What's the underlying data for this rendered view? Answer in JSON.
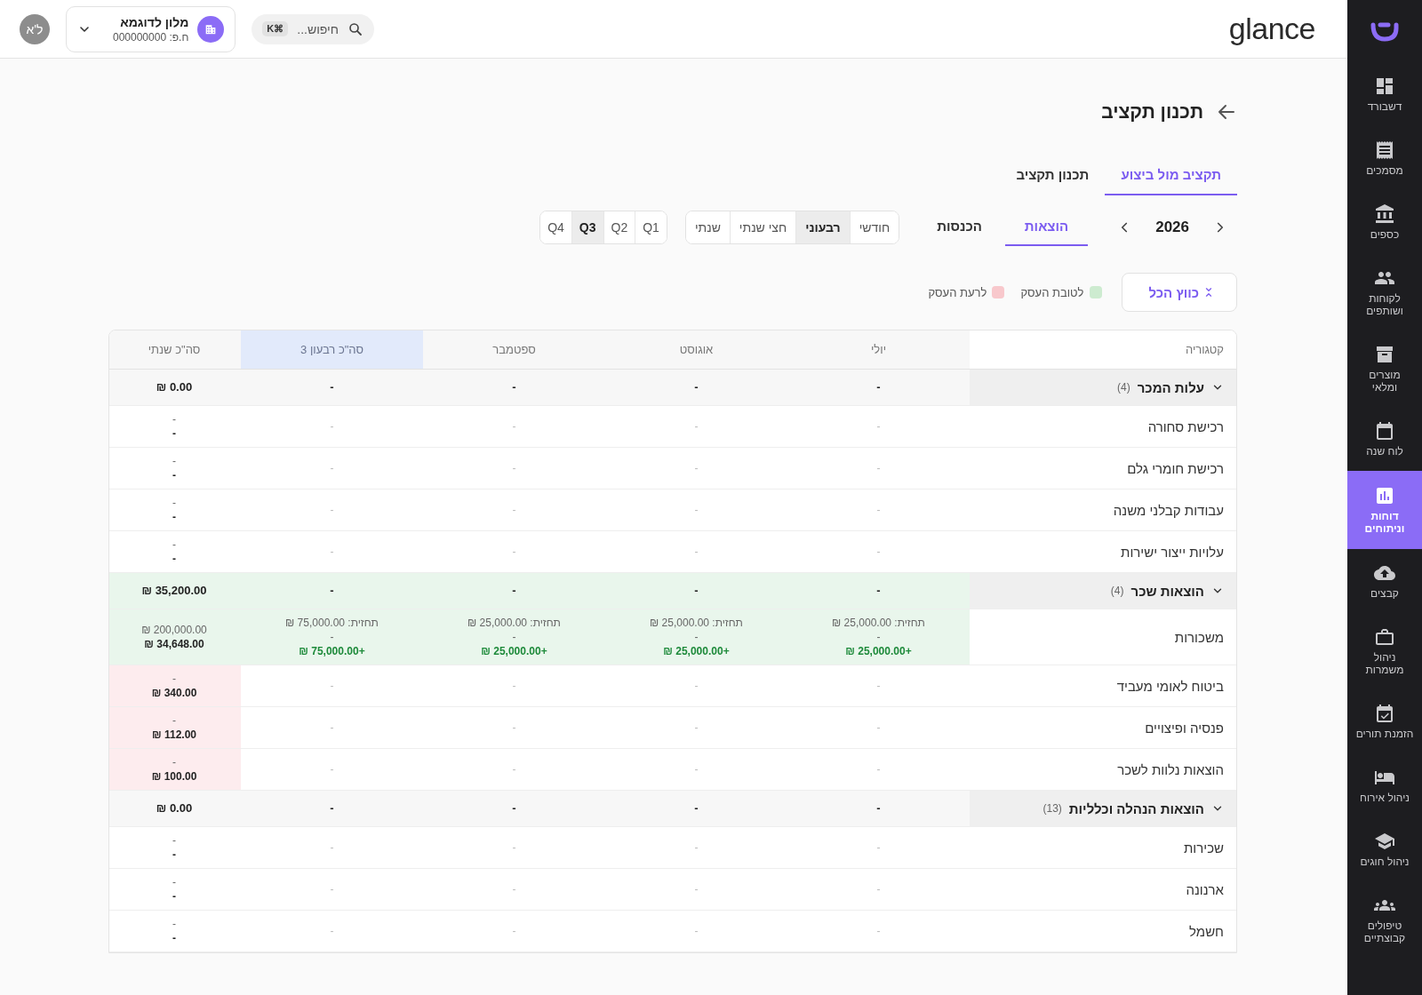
{
  "sidebar": {
    "items": [
      {
        "label": "דשבורד",
        "selected": false
      },
      {
        "label": "מסמכים",
        "selected": false
      },
      {
        "label": "כספים",
        "selected": false
      },
      {
        "label": "לקוחות ושותפים",
        "selected": false
      },
      {
        "label": "מוצרים ומלאי",
        "selected": false
      },
      {
        "label": "לוח שנה",
        "selected": false
      },
      {
        "label": "דוחות וניתוחים",
        "selected": true
      },
      {
        "label": "קבצים",
        "selected": false
      },
      {
        "label": "ניהול משמרות",
        "selected": false
      },
      {
        "label": "הזמנת תורים",
        "selected": false
      },
      {
        "label": "ניהול אירוח",
        "selected": false
      },
      {
        "label": "ניהול חוגים",
        "selected": false
      },
      {
        "label": "טיפולים קבוצתיים",
        "selected": false
      }
    ]
  },
  "top_bar": {
    "logo": "glance",
    "search": {
      "placeholder": "חיפוש...",
      "shortcut": "⌘K"
    },
    "business": {
      "name": "מלון לדוגמא",
      "id": "ח.פ: 000000000"
    },
    "avatar": "ל'א"
  },
  "page": {
    "title": "תכנון תקציב"
  },
  "view_tabs": [
    {
      "label": "תקציב מול ביצוע",
      "selected": true
    },
    {
      "label": "תכנון תקציב",
      "selected": false
    }
  ],
  "year": "2026",
  "type_tabs": [
    {
      "label": "הוצאות",
      "selected": true
    },
    {
      "label": "הכנסות",
      "selected": false
    }
  ],
  "periods": [
    {
      "label": "חודשי",
      "selected": false
    },
    {
      "label": "רבעוני",
      "selected": true
    },
    {
      "label": "חצי שנתי",
      "selected": false
    },
    {
      "label": "שנתי",
      "selected": false
    }
  ],
  "quarters": [
    {
      "label": "Q1",
      "selected": false
    },
    {
      "label": "Q2",
      "selected": false
    },
    {
      "label": "Q3",
      "selected": true
    },
    {
      "label": "Q4",
      "selected": false
    }
  ],
  "collapse_button": "כווץ הכל",
  "legend": [
    {
      "label": "לטובת העסק",
      "color": "#cdebd0"
    },
    {
      "label": "לרעת העסק",
      "color": "#f8c8cc"
    }
  ],
  "table": {
    "columns": [
      {
        "label": "קטגוריה",
        "highlighted": false
      },
      {
        "label": "יולי",
        "highlighted": false
      },
      {
        "label": "אוגוסט",
        "highlighted": false
      },
      {
        "label": "ספטמבר",
        "highlighted": false
      },
      {
        "label": "סה\"כ רבעון 3",
        "highlighted": true
      },
      {
        "label": "סה\"כ שנתי",
        "highlighted": false
      }
    ],
    "rows": [
      {
        "kind": "group",
        "expanded": true,
        "cells": [
          {
            "text": "עלות המכר",
            "count": "(4)"
          },
          {
            "lines": [
              {
                "kind": "total",
                "text": "-"
              }
            ]
          },
          {
            "lines": [
              {
                "kind": "total",
                "text": "-"
              }
            ]
          },
          {
            "lines": [
              {
                "kind": "total",
                "text": "-"
              }
            ]
          },
          {
            "lines": [
              {
                "kind": "total",
                "text": "-"
              }
            ]
          },
          {
            "lines": [
              {
                "kind": "total",
                "text": "0.00 ₪"
              }
            ]
          }
        ]
      },
      {
        "kind": "item",
        "cells": [
          {
            "text": "רכישת סחורה"
          },
          {
            "lines": [
              {
                "kind": "empty",
                "text": "-"
              }
            ]
          },
          {
            "lines": [
              {
                "kind": "empty",
                "text": "-"
              }
            ]
          },
          {
            "lines": [
              {
                "kind": "empty",
                "text": "-"
              }
            ]
          },
          {
            "lines": [
              {
                "kind": "empty",
                "text": "-"
              }
            ]
          },
          {
            "lines": [
              {
                "kind": "forecast",
                "text": "-"
              },
              {
                "kind": "actual",
                "text": "-"
              }
            ]
          }
        ]
      },
      {
        "kind": "item",
        "cells": [
          {
            "text": "רכישת חומרי גלם"
          },
          {
            "lines": [
              {
                "kind": "empty",
                "text": "-"
              }
            ]
          },
          {
            "lines": [
              {
                "kind": "empty",
                "text": "-"
              }
            ]
          },
          {
            "lines": [
              {
                "kind": "empty",
                "text": "-"
              }
            ]
          },
          {
            "lines": [
              {
                "kind": "empty",
                "text": "-"
              }
            ]
          },
          {
            "lines": [
              {
                "kind": "forecast",
                "text": "-"
              },
              {
                "kind": "actual",
                "text": "-"
              }
            ]
          }
        ]
      },
      {
        "kind": "item",
        "cells": [
          {
            "text": "עבודות קבלני משנה"
          },
          {
            "lines": [
              {
                "kind": "empty",
                "text": "-"
              }
            ]
          },
          {
            "lines": [
              {
                "kind": "empty",
                "text": "-"
              }
            ]
          },
          {
            "lines": [
              {
                "kind": "empty",
                "text": "-"
              }
            ]
          },
          {
            "lines": [
              {
                "kind": "empty",
                "text": "-"
              }
            ]
          },
          {
            "lines": [
              {
                "kind": "forecast",
                "text": "-"
              },
              {
                "kind": "actual",
                "text": "-"
              }
            ]
          }
        ]
      },
      {
        "kind": "item",
        "cells": [
          {
            "text": "עלויות ייצור ישירות"
          },
          {
            "lines": [
              {
                "kind": "empty",
                "text": "-"
              }
            ]
          },
          {
            "lines": [
              {
                "kind": "empty",
                "text": "-"
              }
            ]
          },
          {
            "lines": [
              {
                "kind": "empty",
                "text": "-"
              }
            ]
          },
          {
            "lines": [
              {
                "kind": "empty",
                "text": "-"
              }
            ]
          },
          {
            "lines": [
              {
                "kind": "forecast",
                "text": "-"
              },
              {
                "kind": "actual",
                "text": "-"
              }
            ]
          }
        ]
      },
      {
        "kind": "group",
        "expanded": true,
        "cells": [
          {
            "text": "הוצאות שכר",
            "count": "(4)"
          },
          {
            "color": "#e9f6ec",
            "lines": [
              {
                "kind": "total",
                "text": "-"
              }
            ]
          },
          {
            "color": "#e9f6ec",
            "lines": [
              {
                "kind": "total",
                "text": "-"
              }
            ]
          },
          {
            "color": "#e9f6ec",
            "lines": [
              {
                "kind": "total",
                "text": "-"
              }
            ]
          },
          {
            "color": "#e9f6ec",
            "lines": [
              {
                "kind": "total",
                "text": "-"
              }
            ]
          },
          {
            "color": "#e9f6ec",
            "lines": [
              {
                "kind": "total",
                "text": "35,200.00 ₪"
              }
            ]
          }
        ]
      },
      {
        "kind": "item",
        "cells": [
          {
            "text": "משכורות"
          },
          {
            "color": "#e9f6ec",
            "lines": [
              {
                "kind": "forecast",
                "text": "תחזית: 25,000.00 ₪"
              },
              {
                "kind": "forecast",
                "text": "-"
              },
              {
                "kind": "variance",
                "text": "+25,000.00 ₪"
              }
            ]
          },
          {
            "color": "#e9f6ec",
            "lines": [
              {
                "kind": "forecast",
                "text": "תחזית: 25,000.00 ₪"
              },
              {
                "kind": "forecast",
                "text": "-"
              },
              {
                "kind": "variance",
                "text": "+25,000.00 ₪"
              }
            ]
          },
          {
            "color": "#e9f6ec",
            "lines": [
              {
                "kind": "forecast",
                "text": "תחזית: 25,000.00 ₪"
              },
              {
                "kind": "forecast",
                "text": "-"
              },
              {
                "kind": "variance",
                "text": "+25,000.00 ₪"
              }
            ]
          },
          {
            "color": "#e9f6ec",
            "lines": [
              {
                "kind": "forecast",
                "text": "תחזית: 75,000.00 ₪"
              },
              {
                "kind": "forecast",
                "text": "-"
              },
              {
                "kind": "variance",
                "text": "+75,000.00 ₪"
              }
            ]
          },
          {
            "color": "#e9f6ec",
            "lines": [
              {
                "kind": "forecast",
                "text": "200,000.00 ₪"
              },
              {
                "kind": "actual",
                "text": "34,648.00 ₪"
              }
            ]
          }
        ]
      },
      {
        "kind": "item",
        "cells": [
          {
            "text": "ביטוח לאומי מעביד"
          },
          {
            "lines": [
              {
                "kind": "empty",
                "text": "-"
              }
            ]
          },
          {
            "lines": [
              {
                "kind": "empty",
                "text": "-"
              }
            ]
          },
          {
            "lines": [
              {
                "kind": "empty",
                "text": "-"
              }
            ]
          },
          {
            "lines": [
              {
                "kind": "empty",
                "text": "-"
              }
            ]
          },
          {
            "color": "#fdecee",
            "lines": [
              {
                "kind": "forecast",
                "text": "-"
              },
              {
                "kind": "actual",
                "text": "340.00 ₪"
              }
            ]
          }
        ]
      },
      {
        "kind": "item",
        "cells": [
          {
            "text": "פנסיה ופיצויים"
          },
          {
            "lines": [
              {
                "kind": "empty",
                "text": "-"
              }
            ]
          },
          {
            "lines": [
              {
                "kind": "empty",
                "text": "-"
              }
            ]
          },
          {
            "lines": [
              {
                "kind": "empty",
                "text": "-"
              }
            ]
          },
          {
            "lines": [
              {
                "kind": "empty",
                "text": "-"
              }
            ]
          },
          {
            "color": "#fdecee",
            "lines": [
              {
                "kind": "forecast",
                "text": "-"
              },
              {
                "kind": "actual",
                "text": "112.00 ₪"
              }
            ]
          }
        ]
      },
      {
        "kind": "item",
        "cells": [
          {
            "text": "הוצאות נלוות לשכר"
          },
          {
            "lines": [
              {
                "kind": "empty",
                "text": "-"
              }
            ]
          },
          {
            "lines": [
              {
                "kind": "empty",
                "text": "-"
              }
            ]
          },
          {
            "lines": [
              {
                "kind": "empty",
                "text": "-"
              }
            ]
          },
          {
            "lines": [
              {
                "kind": "empty",
                "text": "-"
              }
            ]
          },
          {
            "color": "#fdecee",
            "lines": [
              {
                "kind": "forecast",
                "text": "-"
              },
              {
                "kind": "actual",
                "text": "100.00 ₪"
              }
            ]
          }
        ]
      },
      {
        "kind": "group",
        "expanded": true,
        "cells": [
          {
            "text": "הוצאות הנהלה וכלליות",
            "count": "(13)"
          },
          {
            "lines": [
              {
                "kind": "total",
                "text": "-"
              }
            ]
          },
          {
            "lines": [
              {
                "kind": "total",
                "text": "-"
              }
            ]
          },
          {
            "lines": [
              {
                "kind": "total",
                "text": "-"
              }
            ]
          },
          {
            "lines": [
              {
                "kind": "total",
                "text": "-"
              }
            ]
          },
          {
            "lines": [
              {
                "kind": "total",
                "text": "0.00 ₪"
              }
            ]
          }
        ]
      },
      {
        "kind": "item",
        "cells": [
          {
            "text": "שכירות"
          },
          {
            "lines": [
              {
                "kind": "empty",
                "text": "-"
              }
            ]
          },
          {
            "lines": [
              {
                "kind": "empty",
                "text": "-"
              }
            ]
          },
          {
            "lines": [
              {
                "kind": "empty",
                "text": "-"
              }
            ]
          },
          {
            "lines": [
              {
                "kind": "empty",
                "text": "-"
              }
            ]
          },
          {
            "lines": [
              {
                "kind": "forecast",
                "text": "-"
              },
              {
                "kind": "actual",
                "text": "-"
              }
            ]
          }
        ]
      },
      {
        "kind": "item",
        "cells": [
          {
            "text": "ארנונה"
          },
          {
            "lines": [
              {
                "kind": "empty",
                "text": "-"
              }
            ]
          },
          {
            "lines": [
              {
                "kind": "empty",
                "text": "-"
              }
            ]
          },
          {
            "lines": [
              {
                "kind": "empty",
                "text": "-"
              }
            ]
          },
          {
            "lines": [
              {
                "kind": "empty",
                "text": "-"
              }
            ]
          },
          {
            "lines": [
              {
                "kind": "forecast",
                "text": "-"
              },
              {
                "kind": "actual",
                "text": "-"
              }
            ]
          }
        ]
      },
      {
        "kind": "item",
        "cells": [
          {
            "text": "חשמל"
          },
          {
            "lines": [
              {
                "kind": "empty",
                "text": "-"
              }
            ]
          },
          {
            "lines": [
              {
                "kind": "empty",
                "text": "-"
              }
            ]
          },
          {
            "lines": [
              {
                "kind": "empty",
                "text": "-"
              }
            ]
          },
          {
            "lines": [
              {
                "kind": "empty",
                "text": "-"
              }
            ]
          },
          {
            "lines": [
              {
                "kind": "forecast",
                "text": "-"
              },
              {
                "kind": "actual",
                "text": "-"
              }
            ]
          }
        ]
      }
    ]
  }
}
